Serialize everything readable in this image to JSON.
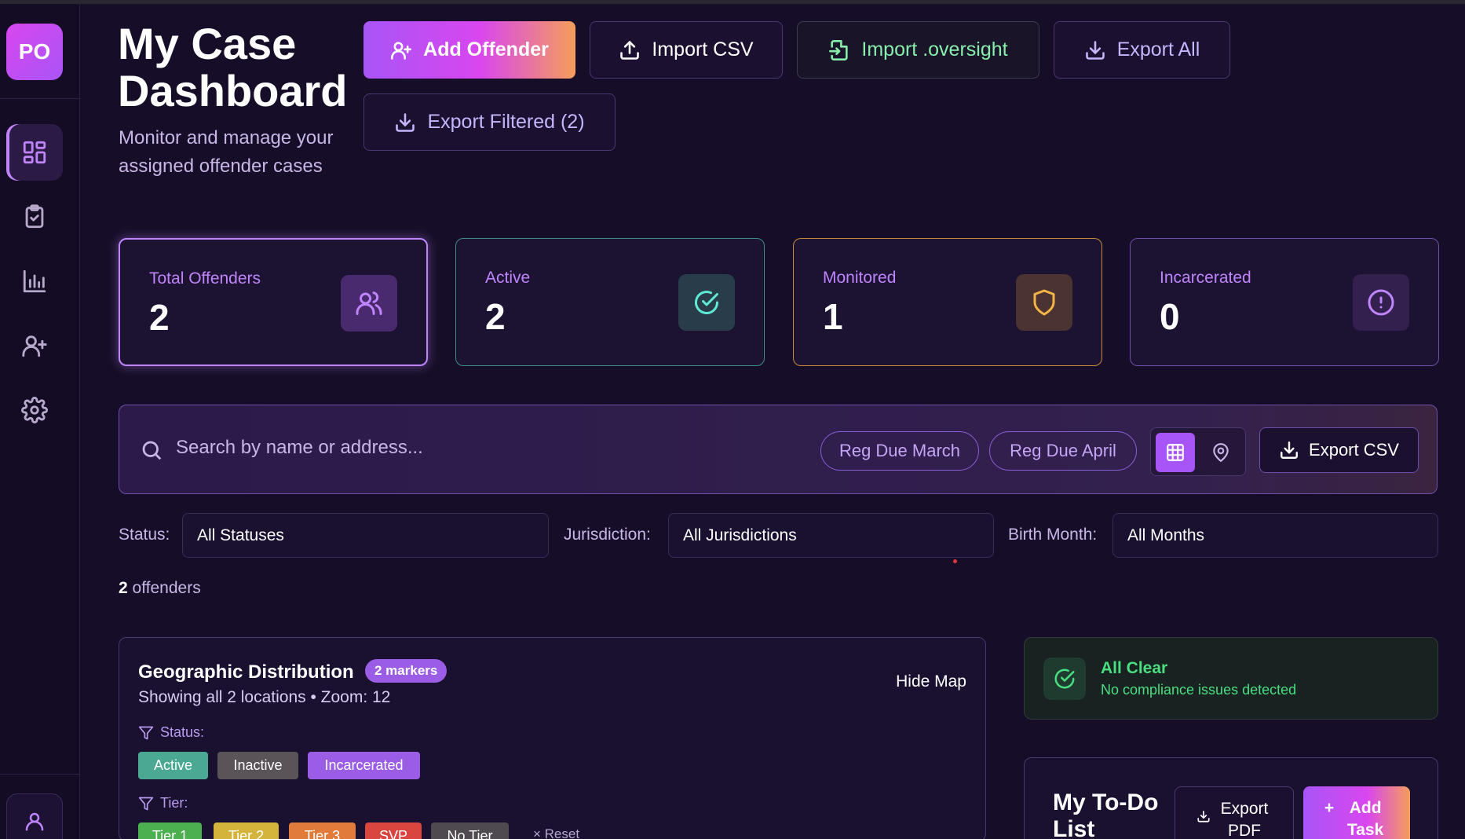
{
  "sidebar": {
    "logo": "PO",
    "items": [
      "dashboard",
      "tasks",
      "analytics",
      "add-user",
      "settings"
    ],
    "active": "dashboard"
  },
  "header": {
    "title": "My Case Dashboard",
    "subtitle": "Monitor and manage your assigned offender cases",
    "buttons": {
      "add_offender": "Add Offender",
      "import_csv": "Import CSV",
      "import_oversight": "Import .oversight",
      "export_all": "Export All",
      "export_filtered": "Export Filtered (2)"
    }
  },
  "stats": [
    {
      "label": "Total Offenders",
      "value": "2",
      "color": "#c084fc"
    },
    {
      "label": "Active",
      "value": "2",
      "color": "#5eead4"
    },
    {
      "label": "Monitored",
      "value": "1",
      "color": "#f5b546"
    },
    {
      "label": "Incarcerated",
      "value": "0",
      "color": "#c084fc"
    }
  ],
  "search": {
    "placeholder": "Search by name or address...",
    "pill_march": "Reg Due March",
    "pill_april": "Reg Due April",
    "export_csv": "Export CSV"
  },
  "filters": {
    "status_label": "Status:",
    "status_value": "All Statuses",
    "jurisdiction_label": "Jurisdiction:",
    "jurisdiction_value": "All Jurisdictions",
    "birth_label": "Birth Month:",
    "birth_value": "All Months"
  },
  "result": {
    "count": "2",
    "suffix": "offenders"
  },
  "map": {
    "title": "Geographic Distribution",
    "badge": "2 markers",
    "subtitle": "Showing all 2 locations • Zoom: 12",
    "hide": "Hide Map",
    "status_label": "Status:",
    "status_chips": [
      "Active",
      "Inactive",
      "Incarcerated"
    ],
    "tier_label": "Tier:",
    "tier_chips": [
      "Tier 1",
      "Tier 2",
      "Tier 3",
      "SVP",
      "No Tier"
    ],
    "reset": "× Reset"
  },
  "compliance": {
    "title": "All Clear",
    "subtitle": "No compliance issues detected"
  },
  "todo": {
    "title": "My To-Do List",
    "export_pdf": "Export PDF",
    "add_task": "Add Task"
  },
  "colors": {
    "accent": "#a855f7",
    "accent_pink": "#d946ef",
    "accent_orange": "#f59e5b",
    "success": "#4ade80"
  }
}
